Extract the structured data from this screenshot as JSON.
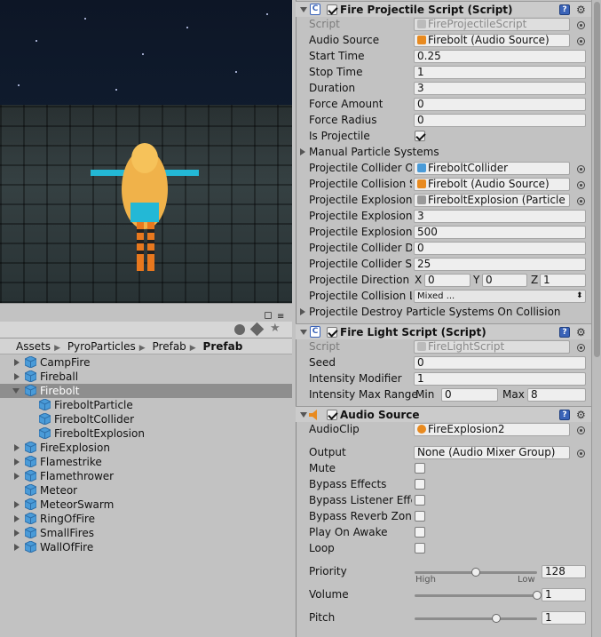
{
  "project": {
    "breadcrumb": [
      "Assets",
      "PyroParticles",
      "Prefab",
      "Prefab"
    ],
    "tree": [
      {
        "label": "CampFire",
        "expanded": false,
        "selected": false,
        "indent": 0
      },
      {
        "label": "Fireball",
        "expanded": false,
        "selected": false,
        "indent": 0
      },
      {
        "label": "Firebolt",
        "expanded": true,
        "selected": true,
        "indent": 0
      },
      {
        "label": "FireboltParticle",
        "expanded": null,
        "selected": false,
        "indent": 1
      },
      {
        "label": "FireboltCollider",
        "expanded": null,
        "selected": false,
        "indent": 1
      },
      {
        "label": "FireboltExplosion",
        "expanded": null,
        "selected": false,
        "indent": 1
      },
      {
        "label": "FireExplosion",
        "expanded": false,
        "selected": false,
        "indent": 0
      },
      {
        "label": "Flamestrike",
        "expanded": false,
        "selected": false,
        "indent": 0
      },
      {
        "label": "Flamethrower",
        "expanded": false,
        "selected": false,
        "indent": 0
      },
      {
        "label": "Meteor",
        "expanded": null,
        "selected": false,
        "indent": 0
      },
      {
        "label": "MeteorSwarm",
        "expanded": false,
        "selected": false,
        "indent": 0
      },
      {
        "label": "RingOfFire",
        "expanded": false,
        "selected": false,
        "indent": 0
      },
      {
        "label": "SmallFires",
        "expanded": false,
        "selected": false,
        "indent": 0
      },
      {
        "label": "WallOfFire",
        "expanded": false,
        "selected": false,
        "indent": 0
      }
    ]
  },
  "fire_projectile": {
    "title": "Fire Projectile Script (Script)",
    "script_label": "Script",
    "script_value": "FireProjectileScript",
    "audio_source_label": "Audio Source",
    "audio_source_value": "Firebolt (Audio Source)",
    "start_time_label": "Start Time",
    "start_time_value": "0.25",
    "stop_time_label": "Stop Time",
    "stop_time_value": "1",
    "duration_label": "Duration",
    "duration_value": "3",
    "force_amount_label": "Force Amount",
    "force_amount_value": "0",
    "force_radius_label": "Force Radius",
    "force_radius_value": "0",
    "is_projectile_label": "Is Projectile",
    "is_projectile_checked": true,
    "manual_particle_label": "Manual Particle Systems",
    "collider_obj_label": "Projectile Collider Ob",
    "collider_obj_value": "FireboltCollider",
    "collision_sound_label": "Projectile Collision S",
    "collision_sound_value": "Firebolt (Audio Source)",
    "explosion_ps_label": "Projectile Explosion I",
    "explosion_ps_value": "FireboltExplosion (Particle S",
    "explosion_radius_label": "Projectile Explosion I",
    "explosion_radius_value": "3",
    "explosion_force_label": "Projectile Explosion I",
    "explosion_force_value": "500",
    "collider_delay_label": "Projectile Collider De",
    "collider_delay_value": "0",
    "collider_speed_label": "Projectile Collider Sp",
    "collider_speed_value": "25",
    "direction_label": "Projectile Direction",
    "direction_x": "0",
    "direction_y": "0",
    "direction_z": "1",
    "collision_layers_label": "Projectile Collision La",
    "collision_layers_value": "Mixed ...",
    "destroy_ps_label": "Projectile Destroy Particle Systems On Collision"
  },
  "fire_light": {
    "title": "Fire Light Script (Script)",
    "script_label": "Script",
    "script_value": "FireLightScript",
    "seed_label": "Seed",
    "seed_value": "0",
    "intensity_modifier_label": "Intensity Modifier",
    "intensity_modifier_value": "1",
    "intensity_range_label": "Intensity Max Range",
    "min_label": "Min",
    "min_value": "0",
    "max_label": "Max",
    "max_value": "8"
  },
  "audio_source": {
    "title": "Audio Source",
    "audioclip_label": "AudioClip",
    "audioclip_value": "FireExplosion2",
    "output_label": "Output",
    "output_value": "None (Audio Mixer Group)",
    "mute_label": "Mute",
    "mute_checked": false,
    "bypass_effects_label": "Bypass Effects",
    "bypass_effects_checked": false,
    "bypass_listener_label": "Bypass Listener Effe",
    "bypass_listener_checked": false,
    "bypass_reverb_label": "Bypass Reverb Zone",
    "bypass_reverb_checked": false,
    "play_on_awake_label": "Play On Awake",
    "play_on_awake_checked": false,
    "loop_label": "Loop",
    "loop_checked": false,
    "priority_label": "Priority",
    "priority_value": "128",
    "priority_level": 0.5,
    "priority_high": "High",
    "priority_low": "Low",
    "volume_label": "Volume",
    "volume_value": "1",
    "volume_level": 1.0,
    "pitch_label": "Pitch",
    "pitch_value": "1",
    "pitch_level": 0.67
  },
  "colors": {
    "selection": "#8e8e8e",
    "panel": "#c2c2c2",
    "accent": "#3a63b8"
  }
}
